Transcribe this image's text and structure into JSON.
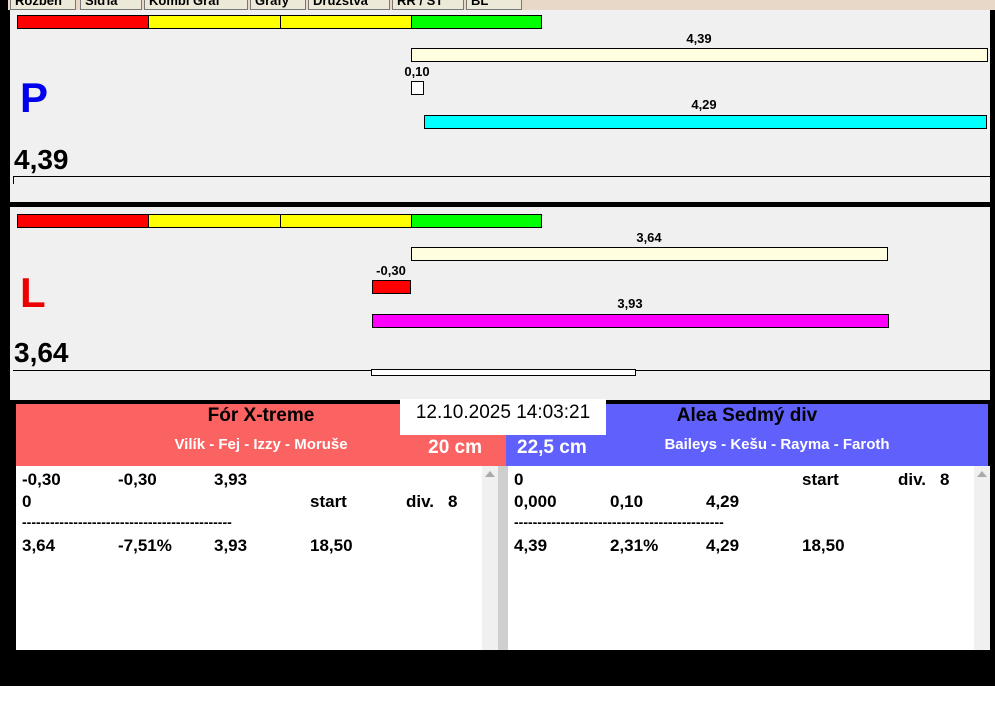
{
  "tabs": [
    {
      "label": "Rozběh"
    },
    {
      "label": "Síďla"
    },
    {
      "label": "Kombi Graf"
    },
    {
      "label": "Grafy"
    },
    {
      "label": "Družstva"
    },
    {
      "label": "RR / ST"
    },
    {
      "label": "BL"
    }
  ],
  "lane_p": {
    "letter": "P",
    "score": "4,39",
    "bar_top_value": "4,39",
    "bar_diff_value": "0,10",
    "bar_bottom_value": "4,29"
  },
  "lane_l": {
    "letter": "L",
    "score": "3,64",
    "bar_top_value": "3,64",
    "bar_diff_value": "-0,30",
    "bar_bottom_value": "3,93"
  },
  "colors": {
    "red": "#ff0000",
    "yellow": "#ffff00",
    "green": "#00ff00",
    "cream": "#ffffe0",
    "cyan": "#00ffff",
    "magenta": "#ff00ff",
    "blue_letter": "#0000ee",
    "red_letter": "#ee0000",
    "team_left_bg": "#fb6262",
    "team_right_bg": "#6060fc"
  },
  "team_left": {
    "name": "Fór X-treme",
    "members": "Vilík - Fej - Izzy - Moruše",
    "distance": "20 cm"
  },
  "team_right": {
    "name": "Alea Sedmý div",
    "members": "Baileys - Kešu - Rayma - Faroth",
    "distance": "22,5 cm"
  },
  "datetime": "12.10.2025 14:03:21",
  "panel_left": {
    "row1": [
      "-0,30",
      "-0,30",
      "3,93"
    ],
    "row2": [
      "0",
      "start",
      "div.",
      "8"
    ],
    "separator": "---------------------------------------------",
    "row3": [
      "3,64",
      "-7,51%",
      "3,93",
      "18,50"
    ]
  },
  "panel_right": {
    "row1": [
      "0",
      "start",
      "div.",
      "8"
    ],
    "row2": [
      "0,000",
      "0,10",
      "4,29"
    ],
    "separator": "---------------------------------------------",
    "row3": [
      "4,39",
      "2,31%",
      "4,29",
      "18,50"
    ]
  }
}
